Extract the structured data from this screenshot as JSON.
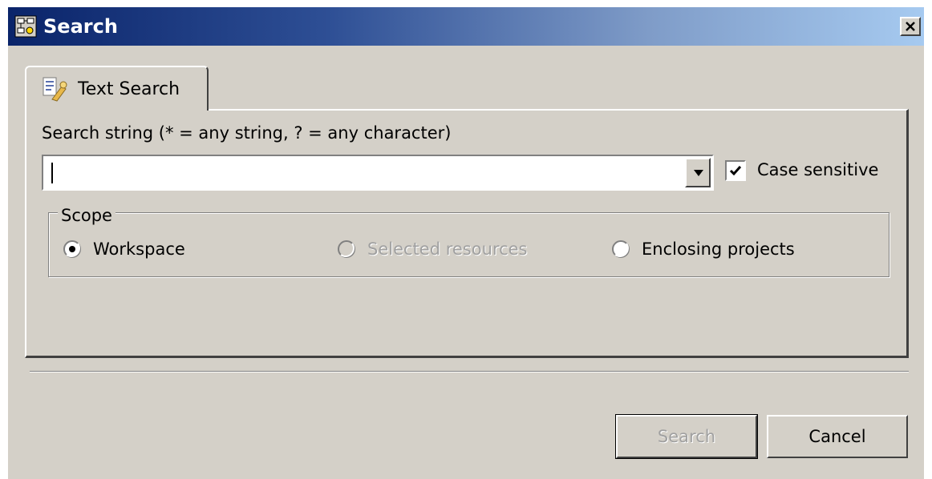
{
  "window": {
    "title": "Search",
    "icon": "search-dialog-icon",
    "close_icon": "close-icon"
  },
  "tab": {
    "label": "Text Search",
    "icon": "text-search-icon"
  },
  "search": {
    "label": "Search string (* = any string, ? = any character)",
    "value": "",
    "dropdown_icon": "chevron-down-icon"
  },
  "case_sensitive": {
    "label": "Case sensitive",
    "checked": true
  },
  "scope": {
    "label": "Scope",
    "options": [
      {
        "label": "Workspace",
        "selected": true,
        "enabled": true
      },
      {
        "label": "Selected resources",
        "selected": false,
        "enabled": false
      },
      {
        "label": "Enclosing projects",
        "selected": false,
        "enabled": true
      }
    ]
  },
  "buttons": {
    "search_label": "Search",
    "search_enabled": false,
    "cancel_label": "Cancel"
  },
  "colors": {
    "title_gradient_start": "#0a246a",
    "title_gradient_end": "#a6caf0",
    "dialog_bg": "#d4d0c8",
    "disabled_text": "#a0a0a0"
  }
}
